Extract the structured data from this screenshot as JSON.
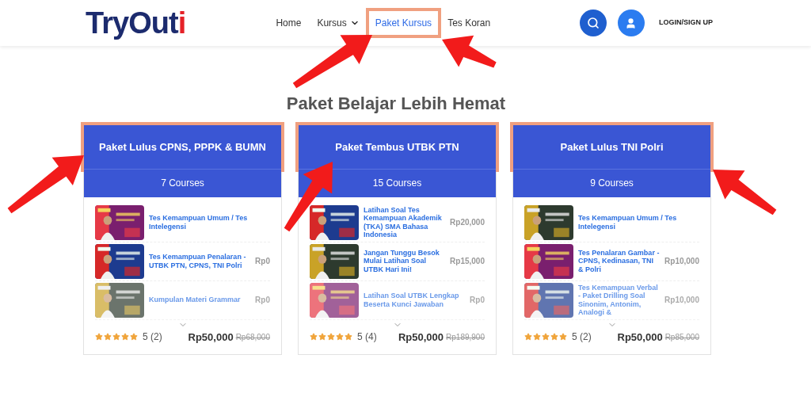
{
  "logo": {
    "name": "TryOut",
    "accent": "i"
  },
  "nav": [
    {
      "label": "Home",
      "selected": false,
      "dropdown": false,
      "highlighted": false
    },
    {
      "label": "Kursus",
      "selected": false,
      "dropdown": true,
      "highlighted": false
    },
    {
      "label": "Paket Kursus",
      "selected": true,
      "dropdown": false,
      "highlighted": true
    },
    {
      "label": "Tes Koran",
      "selected": false,
      "dropdown": false,
      "highlighted": false
    }
  ],
  "login": "LOGIN/SIGN UP",
  "heading": "Paket Belajar Lebih Hemat",
  "packages": [
    {
      "title": "Paket Lulus CPNS, PPPK & BUMN",
      "highlighted": true,
      "courses": "7 Courses",
      "stars": 5,
      "rating": "5 (2)",
      "price": "Rp50,000",
      "old_price": "Rp68,000",
      "items": [
        {
          "title": "Tes Kemampuan Umum / Tes Intelegensi",
          "faded": false
        },
        {
          "title": "Tes Kemampuan Penalaran - UTBK PTN, CPNS, TNI Polri",
          "price": "Rp0",
          "faded": false
        },
        {
          "title": "Kumpulan Materi Grammar",
          "price": "Rp0",
          "faded": true
        }
      ]
    },
    {
      "title": "Paket Tembus UTBK PTN",
      "highlighted": true,
      "courses": "15 Courses",
      "stars": 5,
      "rating": "5 (4)",
      "price": "Rp50,000",
      "old_price": "Rp189,900",
      "items": [
        {
          "title": "Latihan Soal Tes Kemampuan Akademik (TKA) SMA Bahasa Indonesia",
          "price": "Rp20,000",
          "faded": false
        },
        {
          "title": "Jangan Tunggu Besok Mulai Latihan Soal UTBK Hari Ini!",
          "price": "Rp15,000",
          "faded": false
        },
        {
          "title": "Latihan Soal UTBK Lengkap Beserta Kunci Jawaban",
          "price": "Rp0",
          "faded": true
        }
      ]
    },
    {
      "title": "Paket Lulus TNI Polri",
      "highlighted": true,
      "courses": "9 Courses",
      "stars": 5,
      "rating": "5 (2)",
      "price": "Rp50,000",
      "old_price": "Rp85,000",
      "items": [
        {
          "title": "Tes Kemampuan Umum / Tes Intelegensi",
          "faded": false
        },
        {
          "title": "Tes Penalaran Gambar - CPNS, Kedinasan, TNI & Polri",
          "price": "Rp10,000",
          "faded": false
        },
        {
          "title": "Tes Kemampuan Verbal - Paket Drilling Soal Sinonim, Antonim, Analogi &",
          "price": "Rp10,000",
          "faded": true
        }
      ]
    }
  ]
}
